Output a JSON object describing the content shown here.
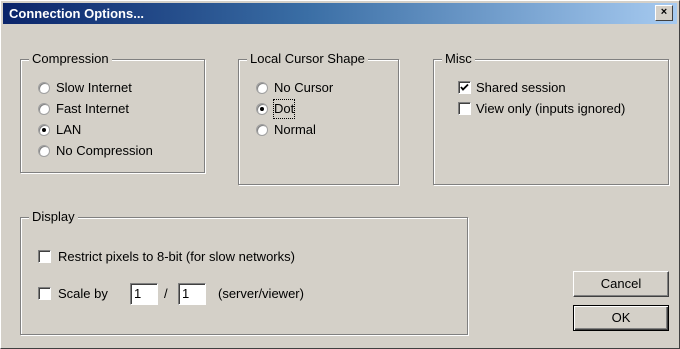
{
  "window": {
    "title": "Connection Options...",
    "close_glyph": "×"
  },
  "compression": {
    "legend": "Compression",
    "options": [
      {
        "label": "Slow Internet",
        "selected": false
      },
      {
        "label": "Fast Internet",
        "selected": false
      },
      {
        "label": "LAN",
        "selected": true
      },
      {
        "label": "No Compression",
        "selected": false
      }
    ]
  },
  "cursor_shape": {
    "legend": "Local Cursor Shape",
    "options": [
      {
        "label": "No Cursor",
        "selected": false
      },
      {
        "label": "Dot",
        "selected": true
      },
      {
        "label": "Normal",
        "selected": false
      }
    ]
  },
  "misc": {
    "legend": "Misc",
    "options": [
      {
        "label": "Shared session",
        "checked": true
      },
      {
        "label": "View only (inputs ignored)",
        "checked": false
      }
    ]
  },
  "display": {
    "legend": "Display",
    "restrict_label": "Restrict pixels to 8-bit (for slow networks)",
    "restrict_checked": false,
    "scale_label": "Scale by",
    "scale_checked": false,
    "scale_numerator": "1",
    "scale_separator": "/",
    "scale_denominator": "1",
    "scale_suffix": "(server/viewer)"
  },
  "buttons": {
    "cancel_label": "Cancel",
    "ok_label": "OK"
  },
  "colors": {
    "dialog_face": "#d4d0c8",
    "title_start": "#0a246a",
    "title_end": "#a6caf0"
  }
}
